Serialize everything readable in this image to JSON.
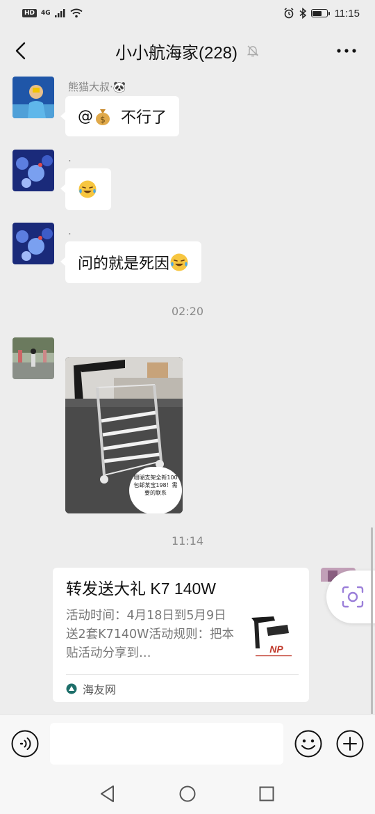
{
  "status_bar": {
    "hd": "HD",
    "network": "4G",
    "time": "11:15",
    "battery_level": 0.7
  },
  "header": {
    "title": "小小航海家(228)"
  },
  "messages": [
    {
      "sender": "熊猫大叔·🐼",
      "text_prefix": "@",
      "text": "不行了"
    },
    {
      "sender": "."
    },
    {
      "sender": ".",
      "text": "问的就是死因"
    }
  ],
  "times": [
    "02:20",
    "11:14"
  ],
  "image_message": {
    "caption": "珊瑚支架全新100包邮某宝198！需要的联系"
  },
  "link_card": {
    "title": "转发送大礼 K7 140W",
    "description": "活动时间：4月18日到5月9日送2套K7140W活动规则：把本贴活动分享到…",
    "thumb_logo": "NP",
    "source": "海友网"
  },
  "input": {
    "value": "",
    "placeholder": ""
  },
  "icons": {
    "back": "chevron-left-icon",
    "mute": "bell-muted-icon",
    "more": "more-dots-icon",
    "voice": "voice-icon",
    "emoji": "emoji-icon",
    "plus": "plus-icon",
    "lens": "scan-lens-icon"
  },
  "colors": {
    "background": "#ededed",
    "bubble": "#ffffff",
    "accent_purple": "#9b7fd9"
  }
}
